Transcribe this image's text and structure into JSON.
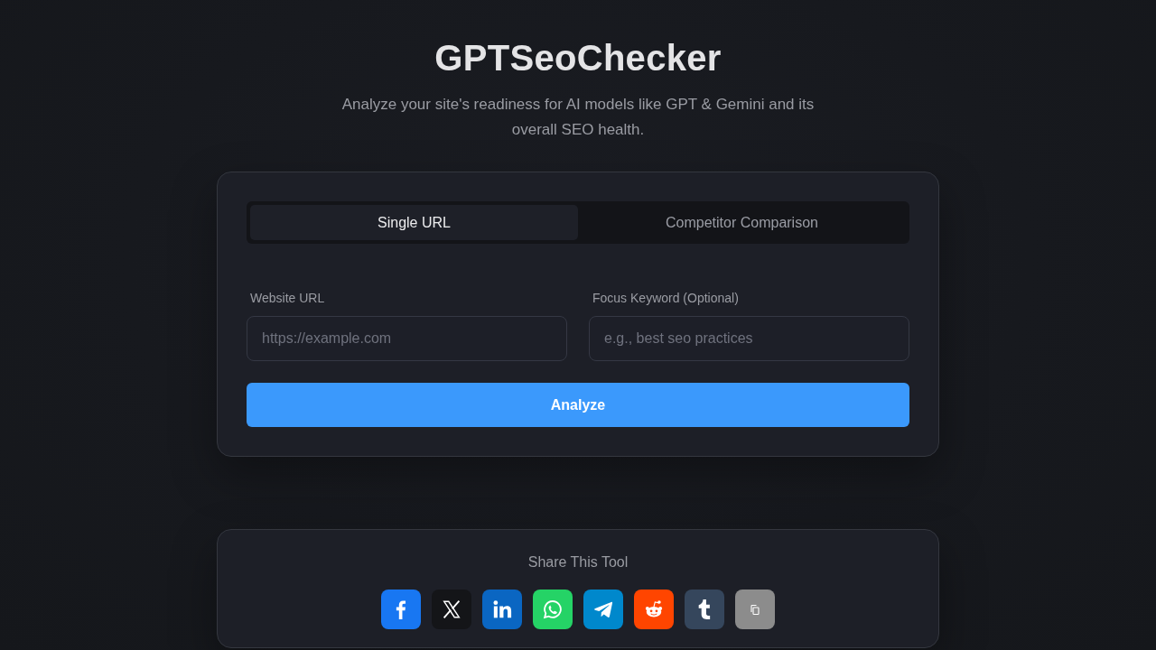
{
  "header": {
    "title": "GPTSeoChecker",
    "subtitle": "Analyze your site's readiness for AI models like GPT & Gemini and its overall SEO health."
  },
  "form_card": {
    "tabs": [
      {
        "label": "Single URL",
        "selected": true
      },
      {
        "label": "Competitor Comparison",
        "selected": false
      }
    ],
    "fields": [
      {
        "label": "Website URL",
        "placeholder": "https://example.com"
      },
      {
        "label": "Focus Keyword (Optional)",
        "placeholder": "e.g., best seo practices"
      }
    ],
    "submit_button": "Analyze"
  },
  "share": {
    "title": "Share This Tool",
    "buttons": [
      {
        "kind": "facebook",
        "color": "#1877f2"
      },
      {
        "kind": "x",
        "color": "#141518"
      },
      {
        "kind": "linkedin",
        "color": "#0a66c2"
      },
      {
        "kind": "whatsapp",
        "color": "#25d366"
      },
      {
        "kind": "telegram",
        "color": "#0088cc"
      },
      {
        "kind": "reddit",
        "color": "#ff4500"
      },
      {
        "kind": "tumblr",
        "color": "#35465c"
      },
      {
        "kind": "copy",
        "color": "#8c8c8c"
      }
    ]
  }
}
